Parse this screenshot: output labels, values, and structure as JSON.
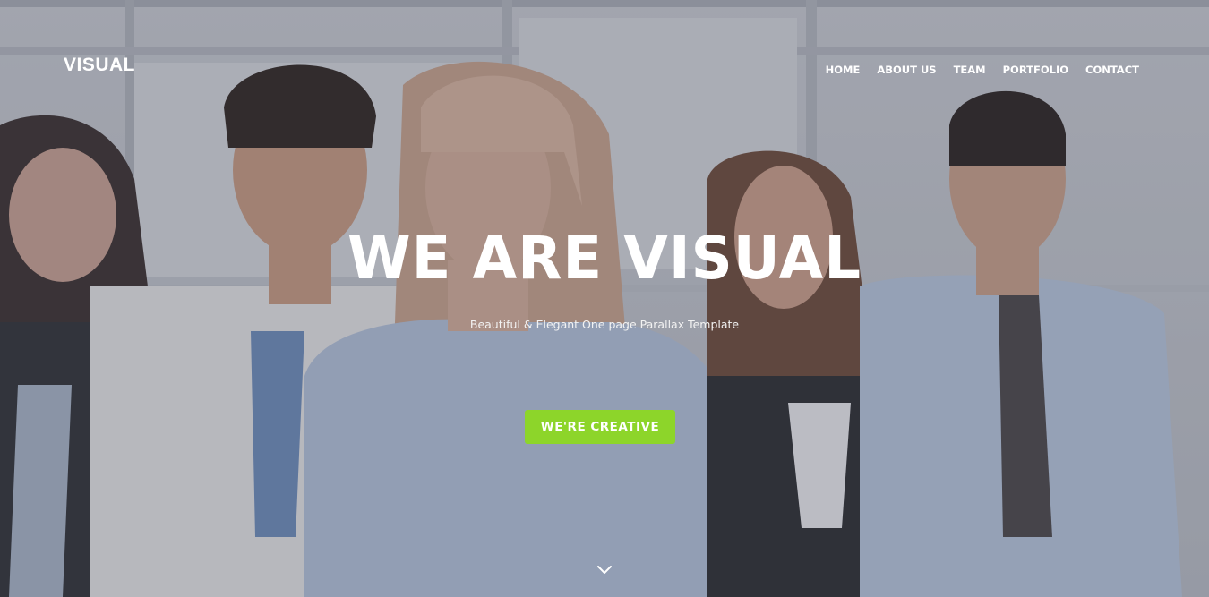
{
  "header": {
    "brand": "VISUAL",
    "nav": [
      {
        "label": "HOME"
      },
      {
        "label": "ABOUT US"
      },
      {
        "label": "TEAM"
      },
      {
        "label": "PORTFOLIO"
      },
      {
        "label": "CONTACT"
      }
    ]
  },
  "hero": {
    "title": "WE ARE VISUAL",
    "subtitle": "Beautiful & Elegant One page Parallax Template",
    "cta_label": "WE'RE CREATIVE",
    "background_image": "team-photo",
    "scroll_icon": "chevron-down-icon"
  },
  "colors": {
    "accent": "#8dd52a",
    "text": "#ffffff",
    "overlay": "#3c404e"
  }
}
